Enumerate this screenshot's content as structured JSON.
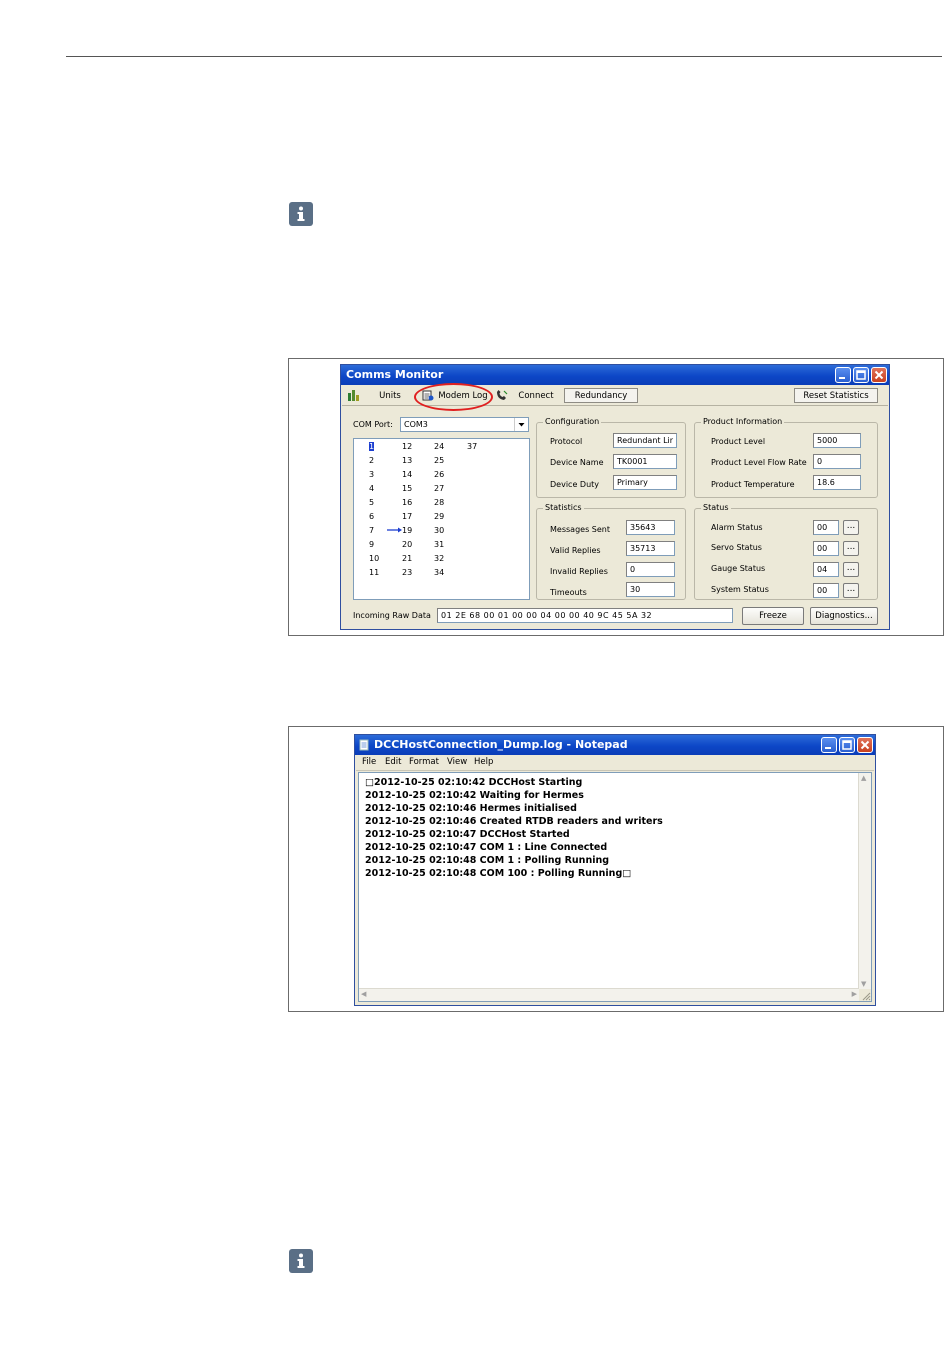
{
  "comms_monitor": {
    "title": "Comms Monitor",
    "toolbar": {
      "units": "Units",
      "modem_log": "Modem Log",
      "connect": "Connect",
      "redundancy": "Redundancy",
      "reset_statistics": "Reset Statistics"
    },
    "com_port": {
      "label": "COM Port:",
      "value": "COM3"
    },
    "port_list": {
      "col1": [
        "1",
        "2",
        "3",
        "4",
        "5",
        "6",
        "7",
        "9",
        "10",
        "11"
      ],
      "col2": [
        "12",
        "13",
        "14",
        "15",
        "16",
        "17",
        "19",
        "20",
        "21",
        "23"
      ],
      "col3": [
        "24",
        "25",
        "26",
        "27",
        "28",
        "29",
        "30",
        "31",
        "32",
        "34"
      ],
      "col4": [
        "37"
      ],
      "arrow_color": "#1d3fd0"
    },
    "configuration": {
      "title": "Configuration",
      "protocol_label": "Protocol",
      "protocol_value": "Redundant Lir",
      "device_name_label": "Device Name",
      "device_name_value": "TK0001",
      "device_duty_label": "Device Duty",
      "device_duty_value": "Primary"
    },
    "product_information": {
      "title": "Product Information",
      "level_label": "Product Level",
      "level_value": "5000",
      "flow_label": "Product Level Flow Rate",
      "flow_value": "0",
      "temp_label": "Product Temperature",
      "temp_value": "18.6"
    },
    "statistics": {
      "title": "Statistics",
      "sent_label": "Messages Sent",
      "sent_value": "35643",
      "valid_label": "Valid Replies",
      "valid_value": "35713",
      "invalid_label": "Invalid Replies",
      "invalid_value": "0",
      "timeouts_label": "Timeouts",
      "timeouts_value": "30"
    },
    "status": {
      "title": "Status",
      "alarm_label": "Alarm Status",
      "alarm_value": "00",
      "servo_label": "Servo Status",
      "servo_value": "00",
      "gauge_label": "Gauge Status",
      "gauge_value": "04",
      "system_label": "System Status",
      "system_value": "00",
      "more_label": "..."
    },
    "raw_data": {
      "label": "Incoming Raw Data",
      "value": "01 2E 68 00 01 00 00 04 00 00 40 9C 45 5A 32"
    },
    "freeze": "Freeze",
    "diagnostics": "Diagnostics..."
  },
  "notepad": {
    "title": "DCCHostConnection_Dump.log - Notepad",
    "menu": [
      "File",
      "Edit",
      "Format",
      "View",
      "Help"
    ],
    "lines": [
      "□2012-10-25 02:10:42 DCCHost Starting",
      "2012-10-25 02:10:42 Waiting for Hermes",
      "2012-10-25 02:10:46 Hermes initialised",
      "2012-10-25 02:10:46 Created RTDB readers and writers",
      "2012-10-25 02:10:47 DCCHost Started",
      "2012-10-25 02:10:47 COM 1 : Line Connected",
      "2012-10-25 02:10:48 COM 1 : Polling Running",
      "2012-10-25 02:10:48 COM 100 : Polling Running□"
    ]
  },
  "colors": {
    "title_bar": "#0d47c7",
    "window_face": "#ece9d8",
    "info_icon": "#5a6f86",
    "highlight_ring": "#e02020"
  },
  "icons": [
    "info-icon",
    "units-icon",
    "modem-log-icon",
    "connect-icon",
    "notepad-app-icon",
    "minimize-icon",
    "maximize-icon",
    "close-icon"
  ]
}
